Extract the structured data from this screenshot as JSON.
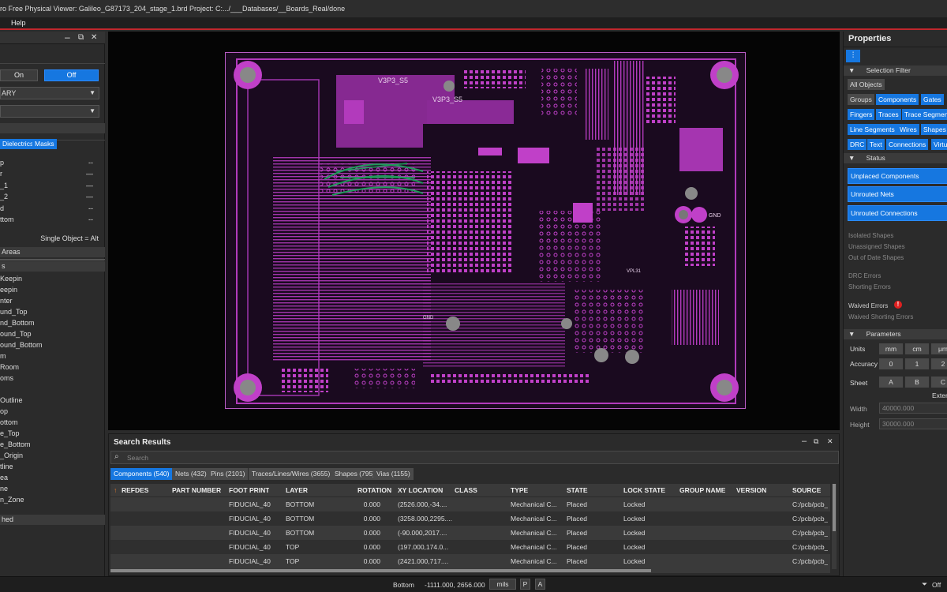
{
  "title": "ro Free Physical Viewer: Galileo_G87173_204_stage_1.brd  Project: C:.../___Databases/__Boards_Real/done",
  "menu": {
    "help": "Help"
  },
  "left": {
    "on": "On",
    "off": "Off",
    "dropdown1": "ARY",
    "dropdown2": "",
    "chips": [
      "Dielectrics",
      "Masks"
    ],
    "layers": [
      {
        "label": "p",
        "dash": "--"
      },
      {
        "label": "r",
        "dash": "—"
      },
      {
        "label": "_1",
        "dash": "—"
      },
      {
        "label": "_2",
        "dash": "—"
      },
      {
        "label": "d",
        "dash": "--"
      },
      {
        "label": "ttom",
        "dash": "--"
      }
    ],
    "single_object": "Single Object = Alt",
    "areas_header": "Areas",
    "s_header": "s",
    "items": [
      "Keepin",
      "eepin",
      "nter",
      "und_Top",
      "nd_Bottom",
      "ound_Top",
      "ound_Bottom",
      "m",
      "Room",
      "oms",
      "",
      "Outline",
      "op",
      "ottom",
      "e_Top",
      "e_Bottom",
      "_Origin",
      "tline",
      "ea",
      "ne",
      "n_Zone"
    ],
    "hed_header": "hed"
  },
  "board_labels": {
    "v3p3_a": "V3P3_S5",
    "v3p3_b": "V3P3_S5",
    "gnd1": "GND",
    "gnd2": "GND",
    "vpl": "VPL31"
  },
  "props": {
    "title": "Properties",
    "selection_filter": "Selection Filter",
    "all_objects": "All Objects",
    "filters": [
      [
        "Groups",
        "Components",
        "Gates"
      ],
      [
        "Fingers",
        "Traces",
        "Trace Segment"
      ],
      [
        "Line Segments",
        "Wires",
        "Shapes"
      ],
      [
        "DRC",
        "Text",
        "Connections",
        "Virtu"
      ]
    ],
    "status_header": "Status",
    "unplaced": "Unplaced Components",
    "unrouted_nets": "Unrouted Nets",
    "unrouted_conn": "Unrouted Connections",
    "isolated": "Isolated Shapes",
    "unassigned": "Unassigned Shapes",
    "outofdate": "Out of Date Shapes",
    "drc_errors": "DRC Errors",
    "shorting": "Shorting Errors",
    "waived": "Waived Errors",
    "waived_short": "Waived Shorting Errors",
    "params_header": "Parameters",
    "units_label": "Units",
    "units": [
      "mm",
      "cm",
      "μm"
    ],
    "accuracy_label": "Accuracy",
    "accuracy": [
      "0",
      "1",
      "2"
    ],
    "sheet_label": "Sheet",
    "sheet": [
      "A",
      "B",
      "C"
    ],
    "extent": "Exter",
    "width_label": "Width",
    "width_val": "40000.000",
    "height_label": "Height",
    "height_val": "30000.000"
  },
  "search": {
    "title": "Search Results",
    "placeholder": "Search",
    "tabs": [
      "Components (540)",
      "Nets (432)",
      "Pins (2101)",
      "Traces/Lines/Wires (3655)",
      "Shapes (795)",
      "Vias (1155)"
    ],
    "columns": [
      "REFDES",
      "PART NUMBER",
      "FOOT PRINT",
      "LAYER",
      "ROTATION",
      "XY LOCATION",
      "CLASS",
      "TYPE",
      "STATE",
      "LOCK STATE",
      "GROUP NAME",
      "VERSION",
      "SOURCE"
    ],
    "rows": [
      [
        "",
        "",
        "FIDUCIAL_40",
        "BOTTOM",
        "0.000",
        "(2526.000,-34....",
        "",
        "Mechanical C...",
        "Placed",
        "Locked",
        "",
        "",
        "C:/pcb/pcb_"
      ],
      [
        "",
        "",
        "FIDUCIAL_40",
        "BOTTOM",
        "0.000",
        "(3258.000,2295....",
        "",
        "Mechanical C...",
        "Placed",
        "Locked",
        "",
        "",
        "C:/pcb/pcb_"
      ],
      [
        "",
        "",
        "FIDUCIAL_40",
        "BOTTOM",
        "0.000",
        "(-90.000,2017....",
        "",
        "Mechanical C...",
        "Placed",
        "Locked",
        "",
        "",
        "C:/pcb/pcb_"
      ],
      [
        "",
        "",
        "FIDUCIAL_40",
        "TOP",
        "0.000",
        "(197.000,174.0...",
        "",
        "Mechanical C...",
        "Placed",
        "Locked",
        "",
        "",
        "C:/pcb/pcb_"
      ],
      [
        "",
        "",
        "FIDUCIAL_40",
        "TOP",
        "0.000",
        "(2421.000,717....",
        "",
        "Mechanical C...",
        "Placed",
        "Locked",
        "",
        "",
        "C:/pcb/pcb_"
      ]
    ]
  },
  "status": {
    "layer": "Bottom",
    "coords": "-1111.000, 2656.000",
    "units": "mils",
    "p": "P",
    "a": "A",
    "filter": "Off"
  },
  "colors": {
    "accent": "#1677e0",
    "copper": "#c040c8",
    "trace_green": "#1f9a5a",
    "error": "#e02020"
  }
}
